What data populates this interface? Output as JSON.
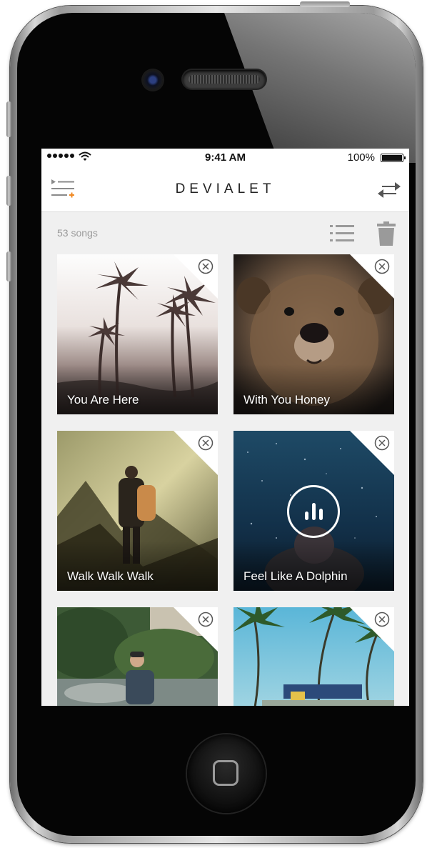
{
  "statusbar": {
    "time": "9:41 AM",
    "battery": "100%"
  },
  "navbar": {
    "brand": "DEVIALET"
  },
  "toolbar": {
    "songs_count": "53 songs"
  },
  "tiles": [
    {
      "title": "You Are Here"
    },
    {
      "title": "With You Honey"
    },
    {
      "title": "Walk Walk Walk"
    },
    {
      "title": "Feel Like A Dolphin",
      "playing": true
    },
    {
      "title": ""
    },
    {
      "title": ""
    }
  ],
  "colors": {
    "accent": "#f08a24",
    "screen_bg": "#f0f0f0",
    "brand_text": "#222222"
  },
  "icons": [
    "queue-icon",
    "shuffle-icon",
    "list-icon",
    "trash-icon",
    "close-icon",
    "equalizer-icon",
    "wifi-icon",
    "battery-icon"
  ]
}
